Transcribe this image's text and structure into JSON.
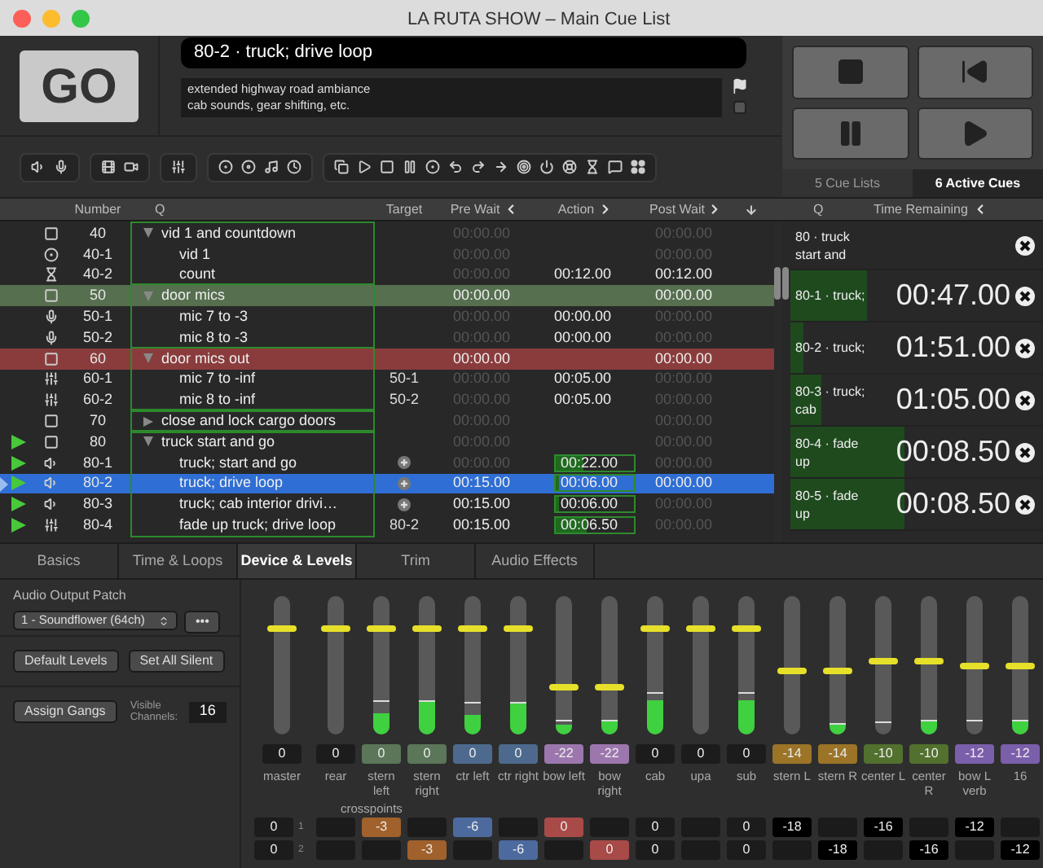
{
  "window": {
    "title": "LA RUTA SHOW – Main Cue List"
  },
  "go_button": {
    "label": "GO"
  },
  "cue_name": "80-2 · truck; drive loop",
  "notes": [
    "extended highway road ambiance",
    "cab sounds, gear shifting, etc."
  ],
  "flag": {
    "checked": false
  },
  "panel_tabs": [
    {
      "label": "5 Cue Lists",
      "selected": false
    },
    {
      "label": "6 Active Cues",
      "selected": true
    }
  ],
  "table": {
    "columns": [
      "Number",
      "Q",
      "Target",
      "Pre Wait",
      "Action",
      "Post Wait"
    ],
    "rows": [
      {
        "kind": "group",
        "number": "40",
        "q": "vid 1 and countdown",
        "expanded": true,
        "selected": false,
        "playing": false,
        "pre_wait": {
          "text": "00:00.00",
          "dim": true
        },
        "post_wait": {
          "text": "00:00.00",
          "dim": true
        },
        "children": [
          {
            "kind": "video",
            "number": "40-1",
            "q": "vid 1",
            "selected": false,
            "playing": false,
            "pre_wait": {
              "text": "00:00.00",
              "dim": true
            },
            "post_wait": {
              "text": "00:00.00",
              "dim": true
            }
          },
          {
            "kind": "timer",
            "number": "40-2",
            "q": "count",
            "selected": false,
            "playing": false,
            "pre_wait": {
              "text": "00:00.00",
              "dim": true
            },
            "action": {
              "text": "00:12.00",
              "dim": false
            },
            "post_wait": {
              "text": "00:12.00",
              "dim": false
            }
          }
        ]
      },
      {
        "kind": "group",
        "number": "50",
        "q": "door mics",
        "expanded": true,
        "selected": false,
        "playing": false,
        "color": "#566f4f",
        "pre_wait": {
          "text": "00:00.00",
          "dim": false
        },
        "post_wait": {
          "text": "00:00.00",
          "dim": false
        },
        "children": [
          {
            "kind": "mic",
            "number": "50-1",
            "q": "mic 7 to -3",
            "selected": false,
            "playing": false,
            "pre_wait": {
              "text": "00:00.00",
              "dim": true
            },
            "action": {
              "text": "00:00.00",
              "dim": false
            },
            "post_wait": {
              "text": "00:00.00",
              "dim": true
            }
          },
          {
            "kind": "mic",
            "number": "50-2",
            "q": "mic 8 to -3",
            "selected": false,
            "playing": false,
            "pre_wait": {
              "text": "00:00.00",
              "dim": true
            },
            "action": {
              "text": "00:00.00",
              "dim": false
            },
            "post_wait": {
              "text": "00:00.00",
              "dim": true
            }
          }
        ]
      },
      {
        "kind": "group",
        "number": "60",
        "q": "door mics out",
        "expanded": true,
        "selected": false,
        "playing": false,
        "color": "#8a3c3c",
        "pre_wait": {
          "text": "00:00.00",
          "dim": false
        },
        "post_wait": {
          "text": "00:00.00",
          "dim": false
        },
        "children": [
          {
            "kind": "fade",
            "number": "60-1",
            "q": "mic 7 to -inf",
            "target": "50-1",
            "selected": false,
            "playing": false,
            "pre_wait": {
              "text": "00:00.00",
              "dim": true
            },
            "action": {
              "text": "00:05.00",
              "dim": false
            },
            "post_wait": {
              "text": "00:00.00",
              "dim": true
            }
          },
          {
            "kind": "fade",
            "number": "60-2",
            "q": "mic 8 to -inf",
            "target": "50-2",
            "selected": false,
            "playing": false,
            "pre_wait": {
              "text": "00:00.00",
              "dim": true
            },
            "action": {
              "text": "00:05.00",
              "dim": false
            },
            "post_wait": {
              "text": "00:00.00",
              "dim": true
            }
          }
        ]
      },
      {
        "kind": "group",
        "number": "70",
        "q": "close and lock cargo doors",
        "expanded": false,
        "selected": false,
        "playing": false,
        "pre_wait": {
          "text": "00:00.00",
          "dim": true
        },
        "post_wait": {
          "text": "00:00.00",
          "dim": true
        }
      },
      {
        "kind": "group",
        "number": "80",
        "q": "truck start and go",
        "expanded": true,
        "selected": false,
        "playing": true,
        "pre_wait": {
          "text": "00:00.00",
          "dim": true
        },
        "post_wait": {
          "text": "00:00.00",
          "dim": true
        },
        "children": [
          {
            "kind": "audio",
            "number": "80-1",
            "q": "truck; start and go",
            "selected": false,
            "playing": true,
            "pre_wait": {
              "text": "00:00.00",
              "dim": true
            },
            "action": {
              "text": "00:22.00",
              "dim": false,
              "level": 0.35
            },
            "post_wait": {
              "text": "00:00.00",
              "dim": true
            }
          },
          {
            "kind": "audio",
            "number": "80-2",
            "q": "truck; drive loop",
            "selected": true,
            "playing": true,
            "pre_wait": {
              "text": "00:15.00",
              "dim": false
            },
            "action": {
              "text": "00:06.00",
              "dim": false,
              "level": 0.05
            },
            "post_wait": {
              "text": "00:00.00",
              "dim": false
            }
          },
          {
            "kind": "audio",
            "number": "80-3",
            "q": "truck; cab interior drivi…",
            "selected": false,
            "playing": true,
            "pre_wait": {
              "text": "00:15.00",
              "dim": false
            },
            "action": {
              "text": "00:06.00",
              "dim": false,
              "level": 0.05
            },
            "post_wait": {
              "text": "00:00.00",
              "dim": true
            }
          },
          {
            "kind": "fade",
            "number": "80-4",
            "q": "fade up truck; drive loop",
            "target": "80-2",
            "selected": false,
            "playing": true,
            "pre_wait": {
              "text": "00:15.00",
              "dim": false
            },
            "action": {
              "text": "00:06.50",
              "dim": false,
              "level": 0.4
            },
            "post_wait": {
              "text": "00:00.00",
              "dim": true
            }
          }
        ]
      }
    ]
  },
  "active_cues": {
    "columns": [
      "Q",
      "Time Remaining"
    ],
    "items": [
      {
        "text": "80 · truck start and",
        "level": 0
      },
      {
        "text": "80-1 · truck;",
        "time": "00:47.00",
        "level": 0.3
      },
      {
        "text": "80-2 · truck;",
        "time": "01:51.00",
        "level": 0.05
      },
      {
        "text": "80-3 · truck; cab",
        "time": "01:05.00",
        "level": 0.12
      },
      {
        "text": "80-4 · fade up",
        "time": "00:08.50",
        "level": 0.45
      },
      {
        "text": "80-5 · fade up",
        "time": "00:08.50",
        "level": 0.45
      }
    ]
  },
  "inspector": {
    "tabs": [
      {
        "label": "Basics",
        "selected": false
      },
      {
        "label": "Time & Loops",
        "selected": false
      },
      {
        "label": "Device & Levels",
        "selected": true
      },
      {
        "label": "Trim",
        "selected": false
      },
      {
        "label": "Audio Effects",
        "selected": false
      }
    ],
    "output_patch": {
      "label": "Audio Output Patch",
      "value": "1 - Soundflower (64ch)",
      "more": "•••"
    },
    "buttons": [
      "Default Levels",
      "Set All Silent"
    ],
    "assign_gangs": "Assign Gangs",
    "visible_channels": {
      "label": "Visible Channels:",
      "value": "16"
    },
    "channels": [
      {
        "name": "master",
        "value": "0",
        "color": "#1c1c1c",
        "fader": {
          "level": 0.76
        }
      },
      {
        "name": "rear",
        "value": "0",
        "color": "#1c1c1c",
        "fader": {
          "level": 0.76
        }
      },
      {
        "name": "stern left",
        "value": "0",
        "color": "#5b7658",
        "fader": {
          "level": 0.76
        },
        "meter": {
          "level": 0.15
        },
        "peak": {
          "level": 0.24
        }
      },
      {
        "name": "stern right",
        "value": "0",
        "color": "#5b7658",
        "fader": {
          "level": 0.76
        },
        "meter": {
          "level": 0.24
        },
        "peak": {
          "level": 0.24
        }
      },
      {
        "name": "ctr left",
        "value": "0",
        "color": "#4d6a8e",
        "fader": {
          "level": 0.76
        },
        "meter": {
          "level": 0.14
        },
        "peak": {
          "level": 0.22
        }
      },
      {
        "name": "ctr right",
        "value": "0",
        "color": "#4d6a8e",
        "fader": {
          "level": 0.76
        },
        "meter": {
          "level": 0.22
        },
        "peak": {
          "level": 0.22
        }
      },
      {
        "name": "bow left",
        "value": "-22",
        "color": "#9c77ad",
        "fader": {
          "level": 0.34
        },
        "meter": {
          "level": 0.07
        },
        "peak": {
          "level": 0.1
        }
      },
      {
        "name": "bow right",
        "value": "-22",
        "color": "#9c77ad",
        "fader": {
          "level": 0.34
        },
        "meter": {
          "level": 0.1
        },
        "peak": {
          "level": 0.1
        }
      },
      {
        "name": "cab",
        "value": "0",
        "color": "#1c1c1c",
        "fader": {
          "level": 0.76
        },
        "meter": {
          "level": 0.25
        },
        "peak": {
          "level": 0.3
        }
      },
      {
        "name": "upa",
        "value": "0",
        "color": "#1c1c1c",
        "fader": {
          "level": 0.76
        }
      },
      {
        "name": "sub",
        "value": "0",
        "color": "#1c1c1c",
        "fader": {
          "level": 0.76
        },
        "meter": {
          "level": 0.25
        },
        "peak": {
          "level": 0.3
        }
      },
      {
        "name": "stern L",
        "value": "-14",
        "color": "#9b7428",
        "fader": {
          "level": 0.46
        }
      },
      {
        "name": "stern R",
        "value": "-14",
        "color": "#9b7428",
        "fader": {
          "level": 0.46
        },
        "meter": {
          "level": 0.07
        },
        "peak": {
          "level": 0.07
        }
      },
      {
        "name": "center L",
        "value": "-10",
        "color": "#52702e",
        "fader": {
          "level": 0.53
        },
        "peak": {
          "level": 0.08
        }
      },
      {
        "name": "center R",
        "value": "-10",
        "color": "#52702e",
        "fader": {
          "level": 0.53
        },
        "meter": {
          "level": 0.09
        },
        "peak": {
          "level": 0.09
        }
      },
      {
        "name": "bow L verb",
        "value": "-12",
        "color": "#7a5fab",
        "fader": {
          "level": 0.49
        },
        "peak": {
          "level": 0.09
        }
      },
      {
        "name": "16",
        "value": "-12",
        "color": "#7a5fab",
        "fader": {
          "level": 0.49
        },
        "meter": {
          "level": 0.09
        },
        "peak": {
          "level": 0.09
        }
      }
    ],
    "crosspoints": {
      "label": "crosspoints",
      "rows": [
        {
          "label": "1",
          "cells": [
            {
              "value": "0",
              "color": "#1c1c1c"
            },
            {},
            {
              "value": "-3",
              "color": "#a0612c"
            },
            {},
            {
              "value": "-6",
              "color": "#4d6a9e"
            },
            {},
            {
              "value": "0",
              "color": "#a84a48"
            },
            {},
            {
              "value": "0",
              "color": "#1c1c1c"
            },
            {},
            {
              "value": "0",
              "color": "#1c1c1c"
            },
            {
              "value": "-18",
              "color": "#000000"
            },
            {},
            {
              "value": "-16",
              "color": "#000000"
            },
            {},
            {
              "value": "-12",
              "color": "#000000"
            },
            {}
          ]
        },
        {
          "label": "2",
          "cells": [
            {
              "value": "0",
              "color": "#1c1c1c"
            },
            {},
            {},
            {
              "value": "-3",
              "color": "#a0612c"
            },
            {},
            {
              "value": "-6",
              "color": "#4d6a9e"
            },
            {},
            {
              "value": "0",
              "color": "#a84a48"
            },
            {
              "value": "0",
              "color": "#1c1c1c"
            },
            {},
            {
              "value": "0",
              "color": "#1c1c1c"
            },
            {},
            {
              "value": "-18",
              "color": "#000000"
            },
            {},
            {
              "value": "-16",
              "color": "#000000"
            },
            {},
            {
              "value": "-12",
              "color": "#000000"
            }
          ]
        }
      ]
    }
  }
}
